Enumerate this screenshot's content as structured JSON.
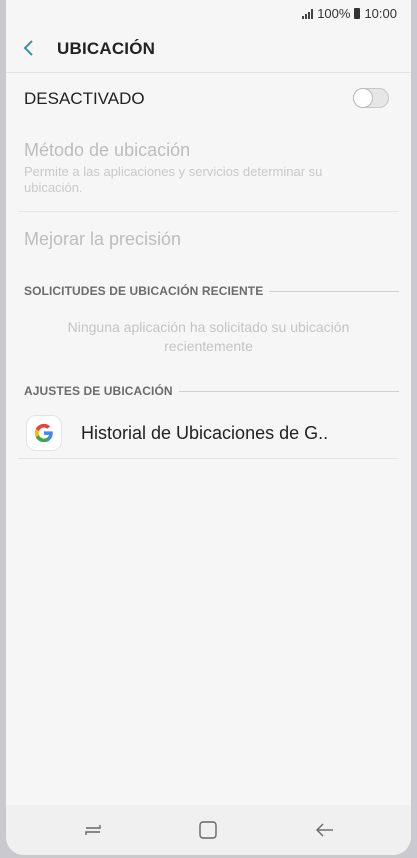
{
  "status_bar": {
    "battery": "100%",
    "time": "10:00"
  },
  "app_bar": {
    "title": "UBICACIÓN"
  },
  "master_switch": {
    "label": "DESACTIVADO",
    "state": "off"
  },
  "method": {
    "label": "Método de ubicación",
    "description": "Permite a las aplicaciones y servicios determinar su ubicación."
  },
  "precision": {
    "label": "Mejorar la precisión"
  },
  "recent_requests": {
    "header": "SOLICITUDES DE UBICACIÓN RECIENTE",
    "empty_message": "Ninguna aplicación ha solicitado su ubicación recientemente"
  },
  "location_settings": {
    "header": "AJUSTES DE UBICACIÓN",
    "items": [
      {
        "label": "Historial de Ubicaciones de G..",
        "icon": "google-icon"
      }
    ]
  },
  "nav_bar": {
    "icons": [
      "recents-icon",
      "home-icon",
      "back-icon"
    ]
  },
  "colors": {
    "accent": "#3e8fa8",
    "disabled_text": "#bdbdbd"
  }
}
